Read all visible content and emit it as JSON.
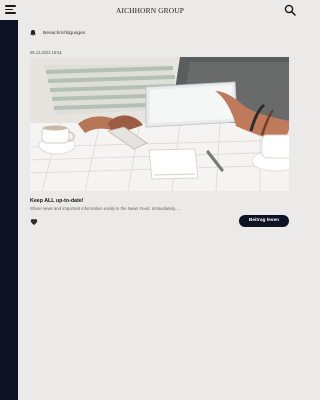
{
  "header": {
    "title": "AICHHORN GROUP",
    "menu_icon": "menu-icon",
    "search_icon": "search-icon"
  },
  "notifications": {
    "label": "Benachrichtigungen",
    "icon": "bell-icon"
  },
  "article": {
    "date": "06.12.2023 18:51",
    "title": "Keep ALL up-to-date!",
    "summary": "Share news and important information easily in the News Feed. Immediately, ...",
    "read_button_label": "Beitrag lesen",
    "like_icon": "heart-icon",
    "image_icon": "image-icon"
  },
  "colors": {
    "background": "#ebeae8",
    "sidebar": "#0d1225",
    "accent": "#0d1225",
    "text": "#1f1f1f"
  }
}
